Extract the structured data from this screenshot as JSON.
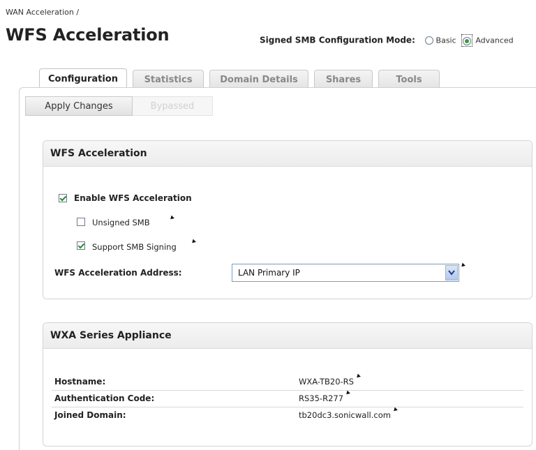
{
  "breadcrumb": "WAN Acceleration /",
  "page_title": "WFS Acceleration",
  "mode": {
    "label": "Signed SMB Configuration Mode:",
    "options": [
      {
        "label": "Basic",
        "selected": false
      },
      {
        "label": "Advanced",
        "selected": true
      }
    ]
  },
  "tabs": [
    {
      "label": "Configuration",
      "active": true
    },
    {
      "label": "Statistics",
      "active": false
    },
    {
      "label": "Domain Details",
      "active": false
    },
    {
      "label": "Shares",
      "active": false
    },
    {
      "label": "Tools",
      "active": false
    }
  ],
  "toolbar": {
    "apply_label": "Apply Changes",
    "bypass_label": "Bypassed"
  },
  "wfs_section": {
    "title": "WFS Acceleration",
    "enable_label": "Enable WFS Acceleration",
    "enable_checked": true,
    "unsigned_label": "Unsigned SMB",
    "unsigned_checked": false,
    "signing_label": "Support SMB Signing",
    "signing_checked": true,
    "address_label": "WFS Acceleration Address:",
    "address_value": "LAN Primary IP"
  },
  "wxa_section": {
    "title": "WXA Series Appliance",
    "rows": [
      {
        "key": "Hostname:",
        "value": "WXA-TB20-RS"
      },
      {
        "key": "Authentication Code:",
        "value": "RS35-R277"
      },
      {
        "key": "Joined Domain:",
        "value": "tb20dc3.sonicwall.com"
      }
    ]
  },
  "colors": {
    "check_green": "#2e8b2e",
    "header_bg": "#ececec",
    "select_border": "#7f9db9"
  }
}
